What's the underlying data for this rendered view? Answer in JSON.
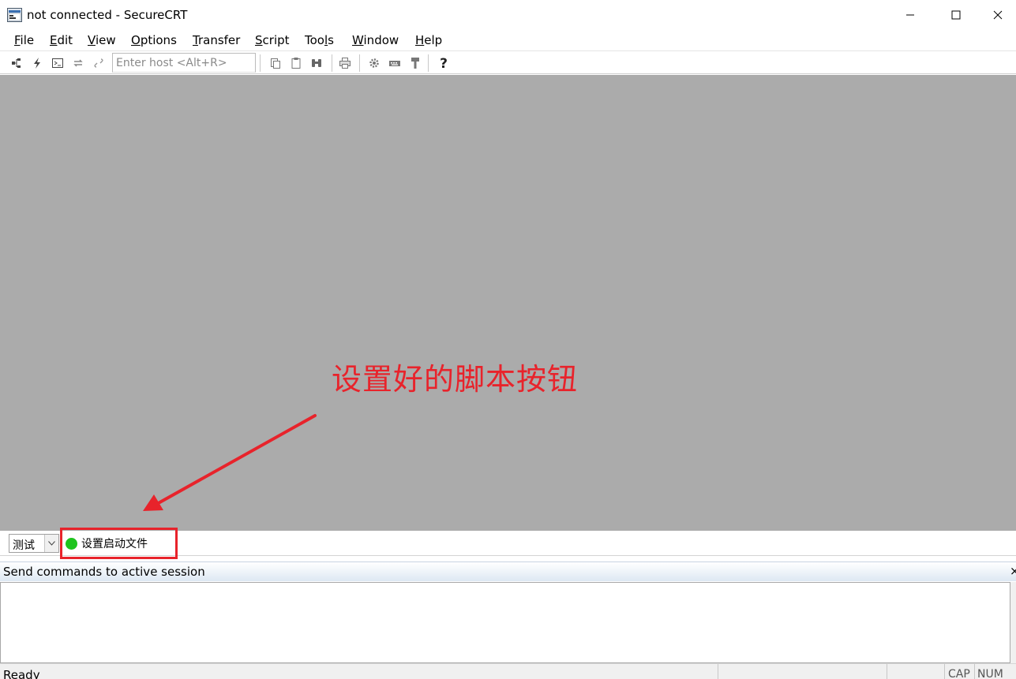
{
  "window": {
    "title": "not connected - SecureCRT"
  },
  "menu": [
    {
      "mnemonic": "F",
      "rest": "ile"
    },
    {
      "mnemonic": "E",
      "rest": "dit"
    },
    {
      "mnemonic": "V",
      "rest": "iew"
    },
    {
      "mnemonic": "O",
      "rest": "ptions"
    },
    {
      "mnemonic": "T",
      "rest": "ransfer"
    },
    {
      "mnemonic": "S",
      "rest": "cript"
    },
    {
      "prefix": "Too",
      "mnemonic": "l",
      "rest": "s"
    },
    {
      "mnemonic": "W",
      "rest": "indow"
    },
    {
      "mnemonic": "H",
      "rest": "elp"
    }
  ],
  "toolbar": {
    "host_placeholder": "Enter host <Alt+R>",
    "icons": [
      "connect-icon",
      "quick-connect-icon",
      "connect-in-tab-icon",
      "reconnect-icon",
      "disconnect-icon",
      "copy-icon",
      "paste-icon",
      "find-icon",
      "print-icon",
      "session-options-icon",
      "keymap-icon",
      "sftp-icon",
      "help-icon"
    ]
  },
  "annotation": {
    "text": "设置好的脚本按钮",
    "color": "#e8232b"
  },
  "buttonbar": {
    "selected": "测试",
    "button_label": "设置启动文件",
    "status_color": "#1ec41e"
  },
  "command_window": {
    "title": "Send commands to active session",
    "close_glyph": "×"
  },
  "statusbar": {
    "ready": "Ready",
    "cap": "CAP",
    "num": "NUM"
  }
}
